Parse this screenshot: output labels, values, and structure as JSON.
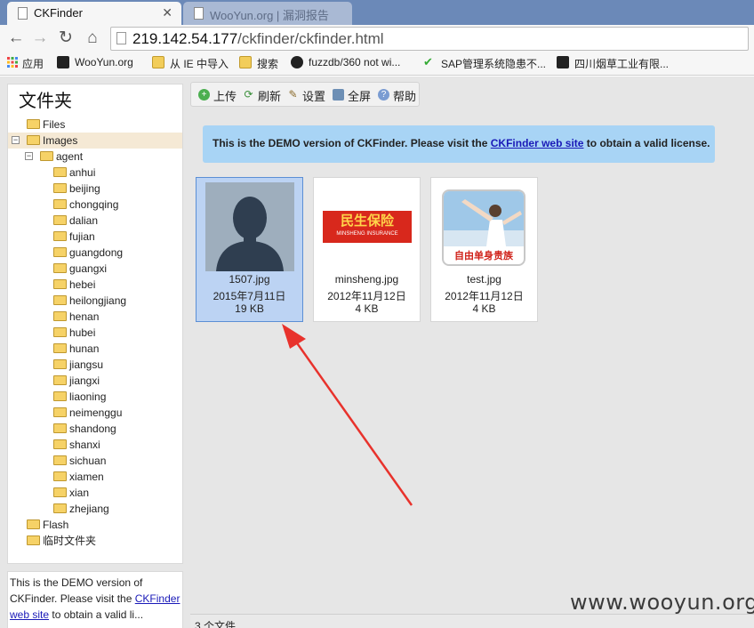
{
  "browser": {
    "active_tab_title": "CKFinder",
    "inactive_tab_title": "WooYun.org | 漏洞报告",
    "url_host": "219.142.54.177",
    "url_path": "/ckfinder/ckfinder.html",
    "bookmarks": [
      "应用",
      "WooYun.org",
      "从 IE 中导入",
      "搜索",
      "fuzzdb/360 not wi...",
      "SAP管理系统隐患不...",
      "四川烟草工业有限..."
    ]
  },
  "sidebar": {
    "title": "文件夹",
    "tree": [
      {
        "label": "Files",
        "level": 1
      },
      {
        "label": "Images",
        "level": 1,
        "expanded": true,
        "selected": true
      },
      {
        "label": "agent",
        "level": 2,
        "expanded": true
      },
      {
        "label": "anhui",
        "level": 3
      },
      {
        "label": "beijing",
        "level": 3
      },
      {
        "label": "chongqing",
        "level": 3
      },
      {
        "label": "dalian",
        "level": 3
      },
      {
        "label": "fujian",
        "level": 3
      },
      {
        "label": "guangdong",
        "level": 3
      },
      {
        "label": "guangxi",
        "level": 3
      },
      {
        "label": "hebei",
        "level": 3
      },
      {
        "label": "heilongjiang",
        "level": 3
      },
      {
        "label": "henan",
        "level": 3
      },
      {
        "label": "hubei",
        "level": 3
      },
      {
        "label": "hunan",
        "level": 3
      },
      {
        "label": "jiangsu",
        "level": 3
      },
      {
        "label": "jiangxi",
        "level": 3
      },
      {
        "label": "liaoning",
        "level": 3
      },
      {
        "label": "neimenggu",
        "level": 3
      },
      {
        "label": "shandong",
        "level": 3
      },
      {
        "label": "shanxi",
        "level": 3
      },
      {
        "label": "sichuan",
        "level": 3
      },
      {
        "label": "xiamen",
        "level": 3
      },
      {
        "label": "xian",
        "level": 3
      },
      {
        "label": "zhejiang",
        "level": 3
      },
      {
        "label": "Flash",
        "level": 1
      },
      {
        "label": "临时文件夹",
        "level": 1
      }
    ],
    "info_text_1": "This is the DEMO version of CKFinder. Please visit the",
    "info_link": "CKFinder web site",
    "info_text_2": "to obtain a valid li..."
  },
  "toolbar": {
    "upload": "上传",
    "refresh": "刷新",
    "settings": "设置",
    "fullscreen": "全屏",
    "help": "帮助"
  },
  "banner": {
    "text_before": "This is the DEMO version of CKFinder. Please visit the",
    "link": "CKFinder web site",
    "text_after": "to obtain a valid license."
  },
  "files": [
    {
      "name": "1507.jpg",
      "date": "2015年7月11日",
      "size": "19 KB",
      "selected": true
    },
    {
      "name": "minsheng.jpg",
      "date": "2012年11月12日",
      "size": "4 KB",
      "thumb_text": "民生保险",
      "thumb_subtext": "MINSHENG INSURANCE"
    },
    {
      "name": "test.jpg",
      "date": "2012年11月12日",
      "size": "4 KB",
      "thumb_text": "自由单身贵族"
    }
  ],
  "status": "3 个文件",
  "watermark": "www.wooyun.org",
  "colors": {
    "annotation_arrow": "#e8322c",
    "tree_selected": "#f5e9d5",
    "banner_bg": "#a8d4f5",
    "file_selected": "#bcd3f3"
  }
}
